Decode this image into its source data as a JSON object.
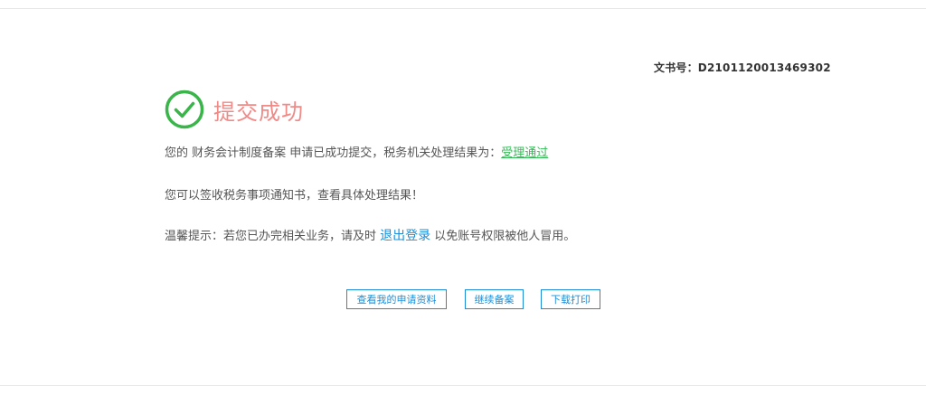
{
  "doc_number": "文书号：D2101120013469302",
  "status": {
    "title": "提交成功",
    "icon": "check-circle-icon",
    "color": "#f08a87",
    "icon_color": "#3ab54a"
  },
  "message": {
    "prefix": "您的 财务会计制度备案 申请已成功提交，税务机关处理结果为：",
    "result": "受理通过",
    "sign_notice": "您可以签收税务事项通知书，查看具体处理结果！",
    "tip_prefix": "温馨提示：若您已办完相关业务，请及时 ",
    "logout_link": "退出登录",
    "tip_suffix": " 以免账号权限被他人冒用。"
  },
  "buttons": {
    "view_application": "查看我的申请资料",
    "continue_filing": "继续备案",
    "download_print": "下载打印"
  }
}
